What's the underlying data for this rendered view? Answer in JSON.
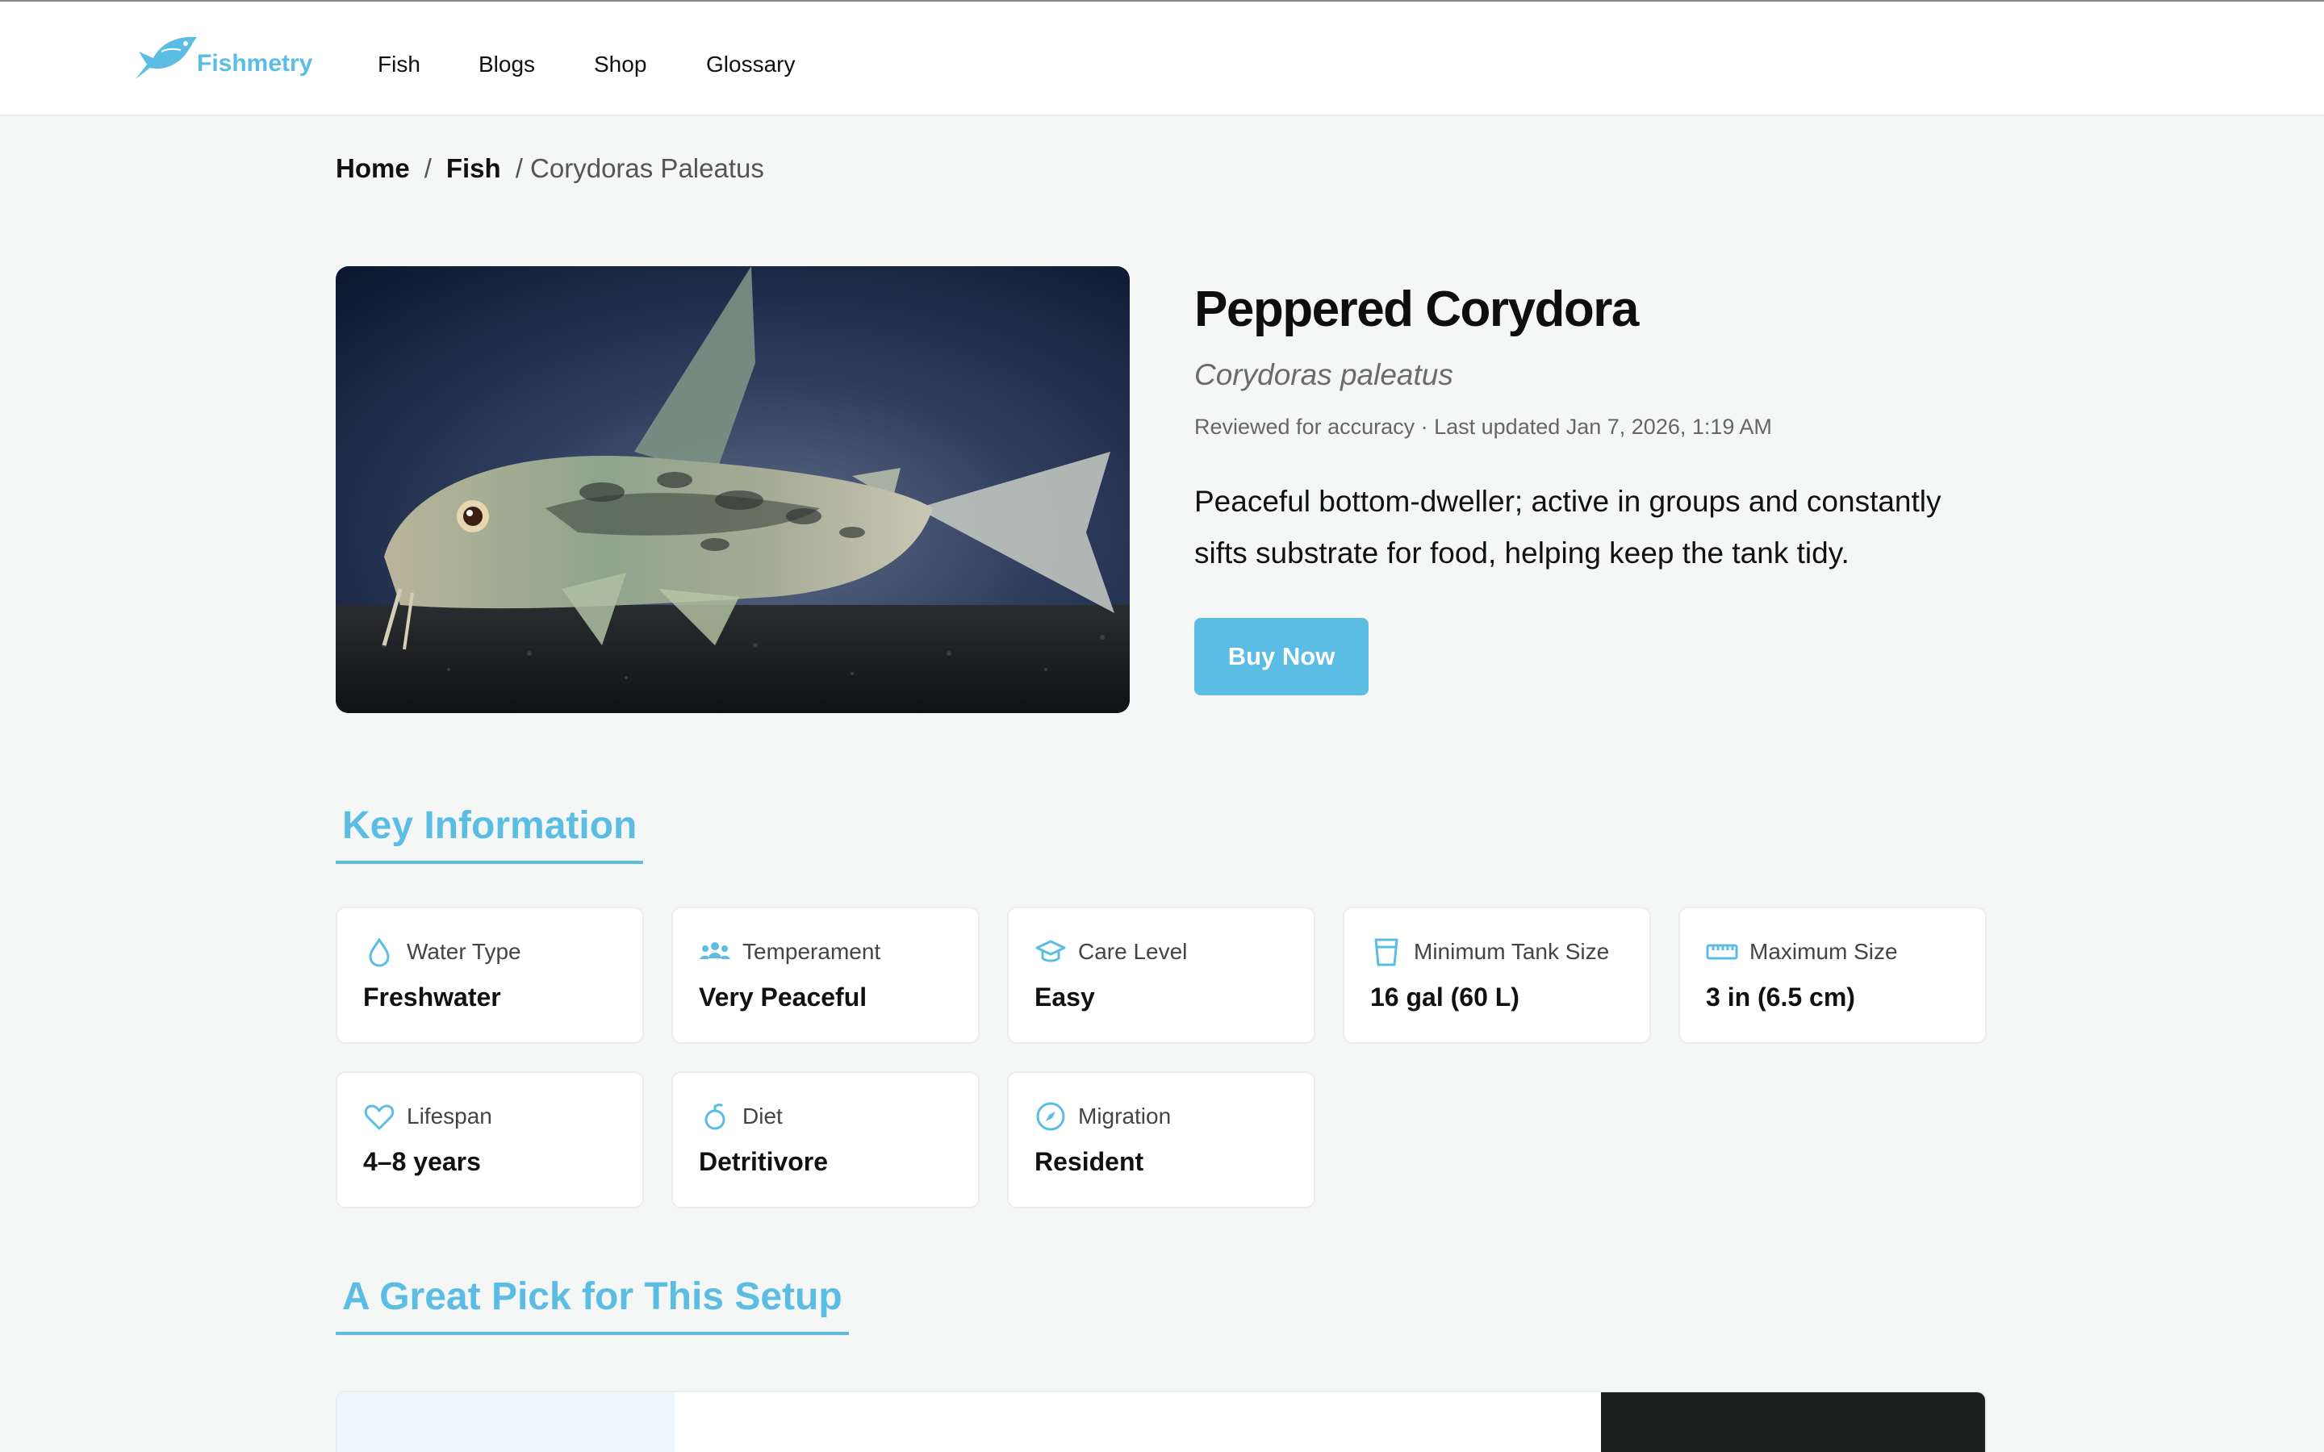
{
  "brand": {
    "name": "Fishmetry",
    "accent": "#5bbde4"
  },
  "nav": [
    {
      "label": "Fish"
    },
    {
      "label": "Blogs"
    },
    {
      "label": "Shop"
    },
    {
      "label": "Glossary"
    }
  ],
  "breadcrumb": {
    "home": "Home",
    "sep": "/",
    "section": "Fish",
    "current": "/ Corydoras Paleatus"
  },
  "fish": {
    "title": "Peppered Corydora",
    "scientific": "Corydoras paleatus",
    "meta": "Reviewed for accuracy · Last updated Jan 7, 2026, 1:19 AM",
    "description": "Peaceful bottom-dweller; active in groups and constantly sifts substrate for food, helping keep the tank tidy.",
    "buy_label": "Buy Now"
  },
  "key_info": {
    "title": "Key Information",
    "cards": [
      {
        "icon": "water-drop-icon",
        "label": "Water Type",
        "value": "Freshwater"
      },
      {
        "icon": "group-icon",
        "label": "Temperament",
        "value": "Very Peaceful"
      },
      {
        "icon": "graduation-cap-icon",
        "label": "Care Level",
        "value": "Easy"
      },
      {
        "icon": "tank-icon",
        "label": "Minimum Tank Size",
        "value": "16 gal (60 L)"
      },
      {
        "icon": "ruler-icon",
        "label": "Maximum Size",
        "value": "3 in (6.5 cm)"
      },
      {
        "icon": "heart-icon",
        "label": "Lifespan",
        "value": "4–8 years"
      },
      {
        "icon": "food-icon",
        "label": "Diet",
        "value": "Detritivore"
      },
      {
        "icon": "compass-icon",
        "label": "Migration",
        "value": "Resident"
      }
    ]
  },
  "setup": {
    "title": "A Great Pick for This Setup"
  }
}
